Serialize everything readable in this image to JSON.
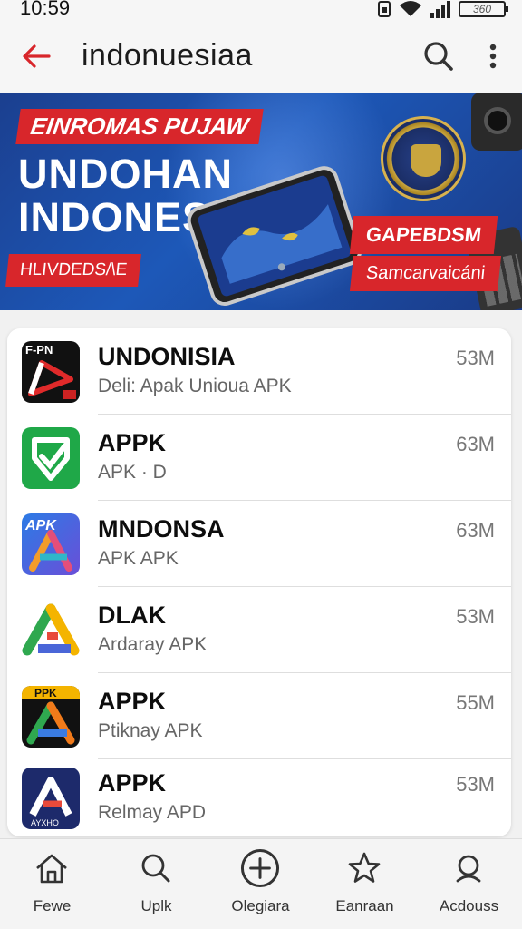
{
  "status_bar": {
    "time": "10:59",
    "battery": "360"
  },
  "app_bar": {
    "search_query": "indonuesiaa"
  },
  "banner": {
    "tag_top": "EINROMAS PUJAW",
    "headline_line1": "UNDOHAN",
    "headline_line2": "INDONESIA",
    "tag_left": "HLIVDEDS/\\E",
    "tag_right_1": "GAPEBDSM",
    "tag_right_2": "Samcarvaicáni"
  },
  "apps": [
    {
      "name": "UNDONISIA",
      "subtitle": "Deli: Apak Unioua APK",
      "size": "53M",
      "icon_text": "F-PN"
    },
    {
      "name": "APPK",
      "subtitle": "APK · D",
      "size": "63M",
      "icon_text": ""
    },
    {
      "name": "MNDONSA",
      "subtitle": "APK APK",
      "size": "63M",
      "icon_text": "APK"
    },
    {
      "name": "DLAK",
      "subtitle": "Ardaray APK",
      "size": "53M",
      "icon_text": ""
    },
    {
      "name": "APPK",
      "subtitle": "Ptiknay APK",
      "size": "55M",
      "icon_text": "PPK"
    },
    {
      "name": "APPK",
      "subtitle": "Relmay APD",
      "size": "53M",
      "icon_text": "AYXHO"
    }
  ],
  "bottom_nav": [
    {
      "label": "Fewe",
      "icon": "home-icon"
    },
    {
      "label": "Uplk",
      "icon": "search-icon"
    },
    {
      "label": "Olegiara",
      "icon": "add-circle-icon"
    },
    {
      "label": "Eanraan",
      "icon": "star-icon"
    },
    {
      "label": "Acdouss",
      "icon": "account-icon"
    }
  ],
  "colors": {
    "accent": "#d8262b",
    "banner_blue": "#1d58b8"
  }
}
